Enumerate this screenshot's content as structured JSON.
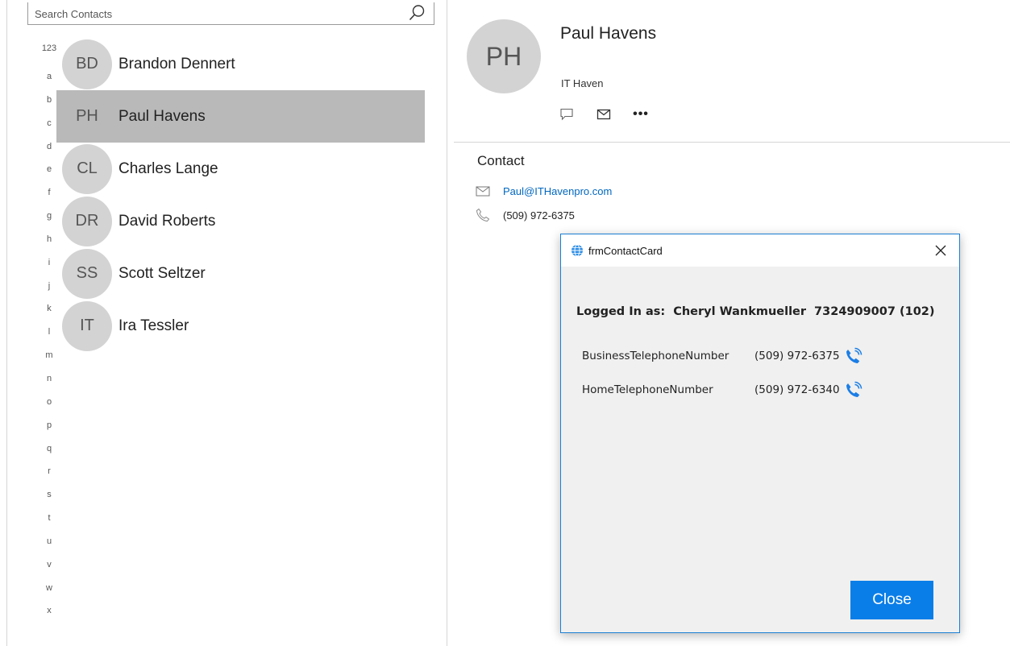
{
  "search": {
    "placeholder": "Search Contacts"
  },
  "alphabet": [
    "123",
    "a",
    "b",
    "c",
    "d",
    "e",
    "f",
    "g",
    "h",
    "i",
    "j",
    "k",
    "l",
    "m",
    "n",
    "o",
    "p",
    "q",
    "r",
    "s",
    "t",
    "u",
    "v",
    "w",
    "x"
  ],
  "contacts": [
    {
      "initials": "BD",
      "name": "Brandon Dennert",
      "selected": false
    },
    {
      "initials": "PH",
      "name": "Paul Havens",
      "selected": true
    },
    {
      "initials": "CL",
      "name": "Charles Lange",
      "selected": false
    },
    {
      "initials": "DR",
      "name": "David Roberts",
      "selected": false
    },
    {
      "initials": "SS",
      "name": "Scott Seltzer",
      "selected": false
    },
    {
      "initials": "IT",
      "name": "Ira Tessler",
      "selected": false
    }
  ],
  "detail": {
    "initials": "PH",
    "name": "Paul Havens",
    "company": "IT Haven",
    "section_title": "Contact",
    "email": "Paul@ITHavenpro.com",
    "phone": "(509) 972-6375",
    "actions": {
      "more_label": "•••"
    }
  },
  "dialog": {
    "title": "frmContactCard",
    "logged_label": "Logged In as:",
    "user_name": "Cheryl Wankmueller",
    "user_id": "7324909007 (102)",
    "phones": [
      {
        "label": "BusinessTelephoneNumber",
        "number": "(509) 972-6375"
      },
      {
        "label": "HomeTelephoneNumber",
        "number": "(509) 972-6340"
      }
    ],
    "close_label": "Close"
  },
  "colors": {
    "accent": "#0a7ee8",
    "link": "#0067c0",
    "selected_row": "#b9b9b9",
    "avatar": "#d3d3d3"
  }
}
